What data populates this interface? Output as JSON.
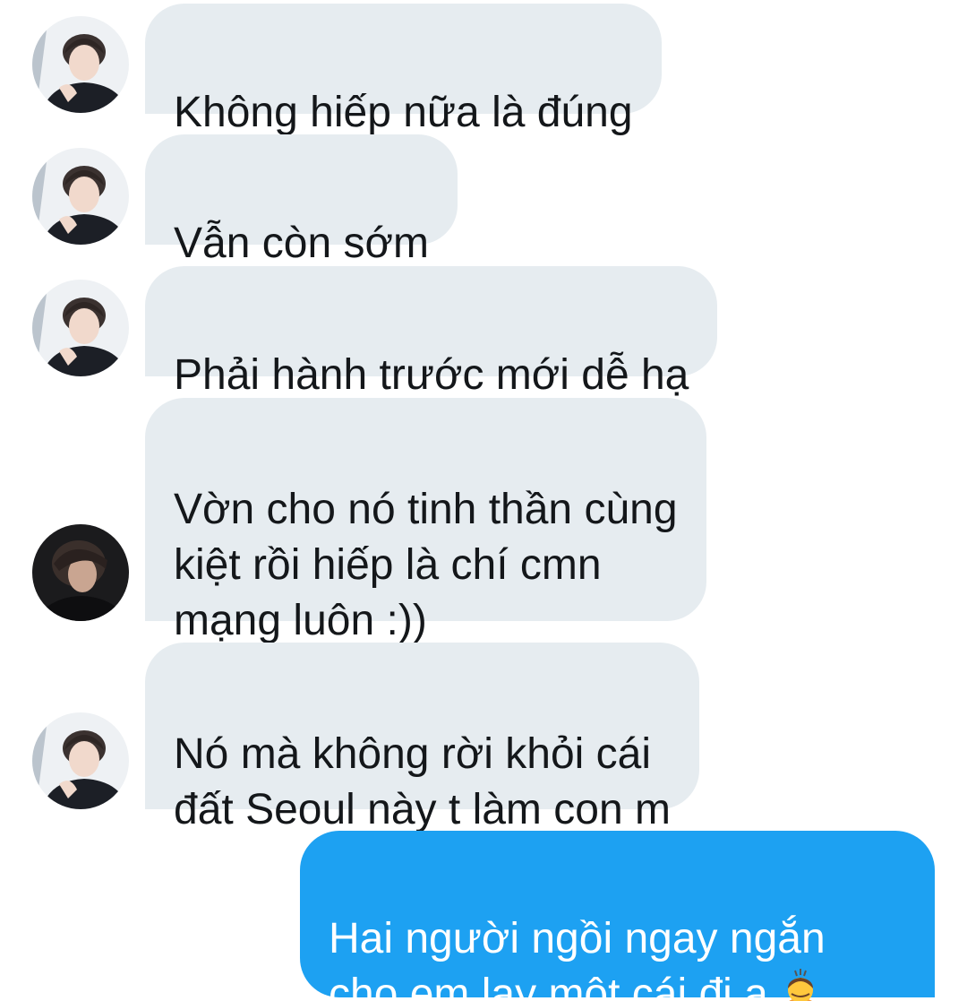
{
  "conversation": {
    "messages": [
      {
        "sender": "other",
        "text": "Không hiếp nữa là đúng"
      },
      {
        "sender": "other",
        "text": "Vẫn còn sớm"
      },
      {
        "sender": "other",
        "text": "Phải hành trước mới dễ hạ"
      },
      {
        "sender": "other",
        "text": "Vờn cho nó tinh thần cùng\nkiệt rồi hiếp là chí cmn\nmạng luôn :))"
      },
      {
        "sender": "other",
        "text": "Nó mà không rời khỏi cái\nđất Seoul này t làm con m"
      },
      {
        "sender": "self",
        "text": "Hai người ngồi ngay ngắn\ncho em lạy một cái đi ạ",
        "emoji": "person-bowing-emoji"
      }
    ]
  },
  "colors": {
    "incoming_bubble": "#e6ecf0",
    "outgoing_bubble": "#1da1f2",
    "incoming_text": "#14171a",
    "outgoing_text": "#ffffff"
  },
  "icons": {
    "avatar_1": "avatar-light-photo",
    "avatar_2": "avatar-dark-photo"
  }
}
